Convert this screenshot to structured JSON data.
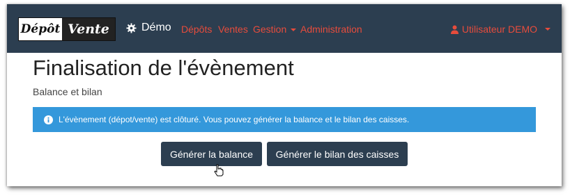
{
  "navbar": {
    "logo": {
      "part1": "Dépôt",
      "part2": "Vente"
    },
    "brand": {
      "icon": "gear-icon",
      "label": "Démo"
    },
    "links": [
      {
        "label": "Dépôts"
      },
      {
        "label": "Ventes"
      },
      {
        "label": "Gestion",
        "dropdown": true
      },
      {
        "label": "Administration"
      }
    ],
    "user": {
      "icon": "user-icon",
      "label": "Utilisateur DEMO",
      "dropdown": true
    }
  },
  "page": {
    "title": "Finalisation de l'évènement",
    "subtitle": "Balance et bilan"
  },
  "alert": {
    "icon": "info-icon",
    "text": "L'évènement (dépot/vente) est clôturé. Vous pouvez générer la balance et le bilan des caisses."
  },
  "actions": {
    "balance_label": "Générer la balance",
    "bilan_label": "Générer le bilan des caisses"
  },
  "colors": {
    "navbar": "#2c3e50",
    "link": "#e74c3c",
    "alert": "#3498db",
    "button": "#2c3e50"
  }
}
